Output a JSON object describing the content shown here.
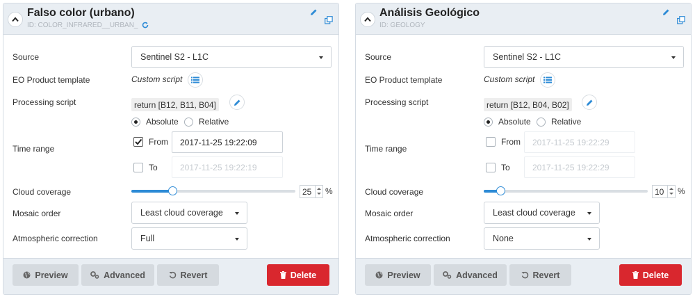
{
  "colors": {
    "accent": "#2d8bd6",
    "danger": "#d9272e",
    "header_bg": "#e9eef3",
    "button_bg": "#d5dadf"
  },
  "labels": {
    "source": "Source",
    "eo_template": "EO Product template",
    "processing_script": "Processing script",
    "time_range": "Time range",
    "cloud_coverage": "Cloud coverage",
    "mosaic_order": "Mosaic order",
    "atmospheric_correction": "Atmospheric correction",
    "absolute": "Absolute",
    "relative": "Relative",
    "from": "From",
    "to": "To",
    "custom_script": "Custom script",
    "percent": "%"
  },
  "footer": {
    "preview": "Preview",
    "advanced": "Advanced",
    "revert": "Revert",
    "delete": "Delete"
  },
  "panels": [
    {
      "title": "Falso color (urbano)",
      "id_text": "ID: COLOR_INFRARED__URBAN_",
      "source": "Sentinel S2 - L1C",
      "script": "return [B12, B11, B04]",
      "time_mode": "absolute",
      "from_checked": true,
      "from_value": "2017-11-25 19:22:09",
      "to_checked": false,
      "to_value": "2017-11-25 19:22:19",
      "cloud_coverage": "25",
      "cloud_fraction": 0.25,
      "mosaic_order": "Least cloud coverage",
      "atmospheric_correction": "Full"
    },
    {
      "title": "Análisis Geológico",
      "id_text": "ID: GEOLOGY",
      "source": "Sentinel S2 - L1C",
      "script": "return [B12, B04, B02]",
      "time_mode": "absolute",
      "from_checked": false,
      "from_value": "2017-11-25 19:22:29",
      "to_checked": false,
      "to_value": "2017-11-25 19:22:29",
      "cloud_coverage": "10",
      "cloud_fraction": 0.1,
      "mosaic_order": "Least cloud coverage",
      "atmospheric_correction": "None"
    }
  ]
}
